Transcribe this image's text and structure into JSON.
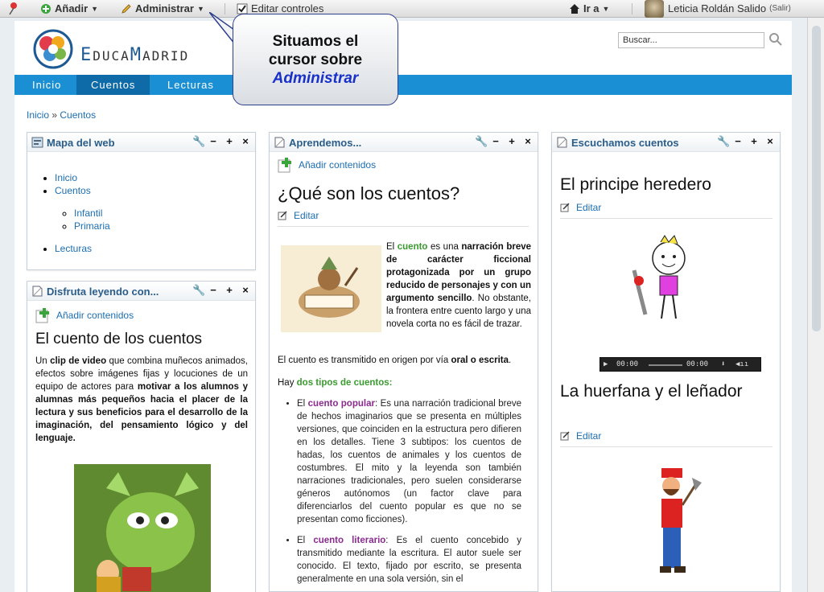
{
  "dockbar": {
    "add_label": "Añadir",
    "manage_label": "Administrar",
    "edit_controls_label": "Editar controles",
    "goto_label": "Ir a",
    "user_name": "Leticia Roldán Salido",
    "logout_label": "(Salir)"
  },
  "header": {
    "brand_initial": "E",
    "brand_mid": "DUCA",
    "brand_initial2": "M",
    "brand_rest": "ADRID",
    "search_value": "Buscar..."
  },
  "nav": {
    "items": [
      "Inicio",
      "Cuentos",
      "Lecturas"
    ],
    "selected": "Cuentos"
  },
  "breadcrumb": {
    "home": "Inicio",
    "sep": "»",
    "current": "Cuentos"
  },
  "callout": {
    "line1": "Situamos el",
    "line2": "cursor sobre",
    "keyword": "Administrar"
  },
  "sitemap": {
    "title": "Mapa del web",
    "items": [
      "Inicio",
      "Cuentos",
      "Infantil",
      "Primaria",
      "Lecturas"
    ]
  },
  "disfruta": {
    "title": "Disfruta leyendo con...",
    "add_label": "Añadir contenidos",
    "heading": "El cuento de los cuentos",
    "text_1": "Un ",
    "text_2": "clip de video",
    "text_3": " que combina muñecos animados, efectos sobre imágenes fijas y locuciones de un equipo de actores para ",
    "text_4": "motivar a los alumnos y alumnas más pequeños hacia el placer de la lectura y sus beneficios para el desarrollo de la imaginación, del pensamiento lógico y del lenguaje."
  },
  "aprendemos": {
    "title": "Aprendemos...",
    "add_label": "Añadir contenidos",
    "heading": "¿Qué son los cuentos?",
    "edit_label": "Editar",
    "p1_a": "El ",
    "p1_b": "cuento",
    "p1_c": " es una ",
    "p1_d": "narración breve de carácter ficcional protagonizada por un grupo reducido de personajes y con un argumento sencillo",
    "p1_e": ". No obstante, la frontera entre cuento largo y una novela corta no es fácil de trazar.",
    "p2_a": "El cuento es transmitido en origen por vía ",
    "p2_b": "oral o escrita",
    "p2_c": ".",
    "p3_a": "Hay ",
    "p3_b": "dos tipos de cuentos:",
    "li1_a": "El ",
    "li1_b": "cuento popular",
    "li1_c": ": Es una narración tradicional breve de hechos imaginarios que se presenta en múltiples versiones, que coinciden en la estructura pero difieren en los detalles. Tiene 3 subtipos: los cuentos de hadas, los cuentos de animales y los cuentos de costumbres. El mito y la leyenda son también narraciones tradicionales, pero suelen considerarse géneros autónomos (un factor clave para diferenciarlos del cuento popular es que no se presentan como ficciones).",
    "li2_a": "El ",
    "li2_b": "cuento literario",
    "li2_c": ": Es el cuento concebido y transmitido mediante la escritura. El autor suele ser conocido. El texto, fijado por escrito, se presenta generalmente en una sola versión, sin el"
  },
  "escuchamos": {
    "title": "Escuchamos cuentos",
    "story1": "El principe heredero",
    "story2": "La huerfana y el leñador",
    "edit_label": "Editar",
    "player_time": "00:00",
    "player_total": "00:00"
  }
}
